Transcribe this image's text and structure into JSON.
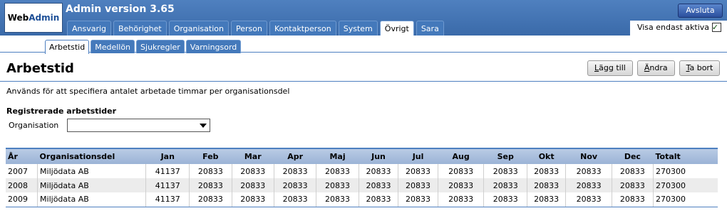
{
  "app": {
    "logo_prefix": "Web",
    "logo_suffix": "Admin",
    "title": "Admin version 3.65",
    "exit_label": "Avsluta"
  },
  "main_tabs": [
    {
      "label": "Ansvarig"
    },
    {
      "label": "Behörighet"
    },
    {
      "label": "Organisation"
    },
    {
      "label": "Person"
    },
    {
      "label": "Kontaktperson"
    },
    {
      "label": "System"
    },
    {
      "label": "Övrigt",
      "active": true
    },
    {
      "label": "Sara"
    }
  ],
  "filter": {
    "label": "Visa endast aktiva",
    "checked": true,
    "check_glyph": "✓"
  },
  "sub_tabs": [
    {
      "label": "Arbetstid",
      "active": true
    },
    {
      "label": "Medellön"
    },
    {
      "label": "Sjukregler"
    },
    {
      "label": "Varningsord"
    }
  ],
  "page": {
    "title": "Arbetstid",
    "description": "Används för att specifiera antalet arbetade timmar per organisationsdel",
    "section_heading": "Registrerade arbetstider",
    "org_label": "Organisation",
    "org_value": ""
  },
  "actions": [
    {
      "key": "L",
      "rest": "ägg till"
    },
    {
      "key": "Ä",
      "rest": "ndra"
    },
    {
      "key": "T",
      "rest": "a bort"
    }
  ],
  "table": {
    "headers": [
      "År",
      "Organisationsdel",
      "Jan",
      "Feb",
      "Mar",
      "Apr",
      "Maj",
      "Jun",
      "Jul",
      "Aug",
      "Sep",
      "Okt",
      "Nov",
      "Dec",
      "Totalt"
    ],
    "rows": [
      [
        "2007",
        "Miljödata AB",
        "41137",
        "20833",
        "20833",
        "20833",
        "20833",
        "20833",
        "20833",
        "20833",
        "20833",
        "20833",
        "20833",
        "20833",
        "270300"
      ],
      [
        "2008",
        "Miljödata AB",
        "41137",
        "20833",
        "20833",
        "20833",
        "20833",
        "20833",
        "20833",
        "20833",
        "20833",
        "20833",
        "20833",
        "20833",
        "270300"
      ],
      [
        "2009",
        "Miljödata AB",
        "41137",
        "20833",
        "20833",
        "20833",
        "20833",
        "20833",
        "20833",
        "20833",
        "20833",
        "20833",
        "20833",
        "20833",
        "270300"
      ]
    ]
  }
}
